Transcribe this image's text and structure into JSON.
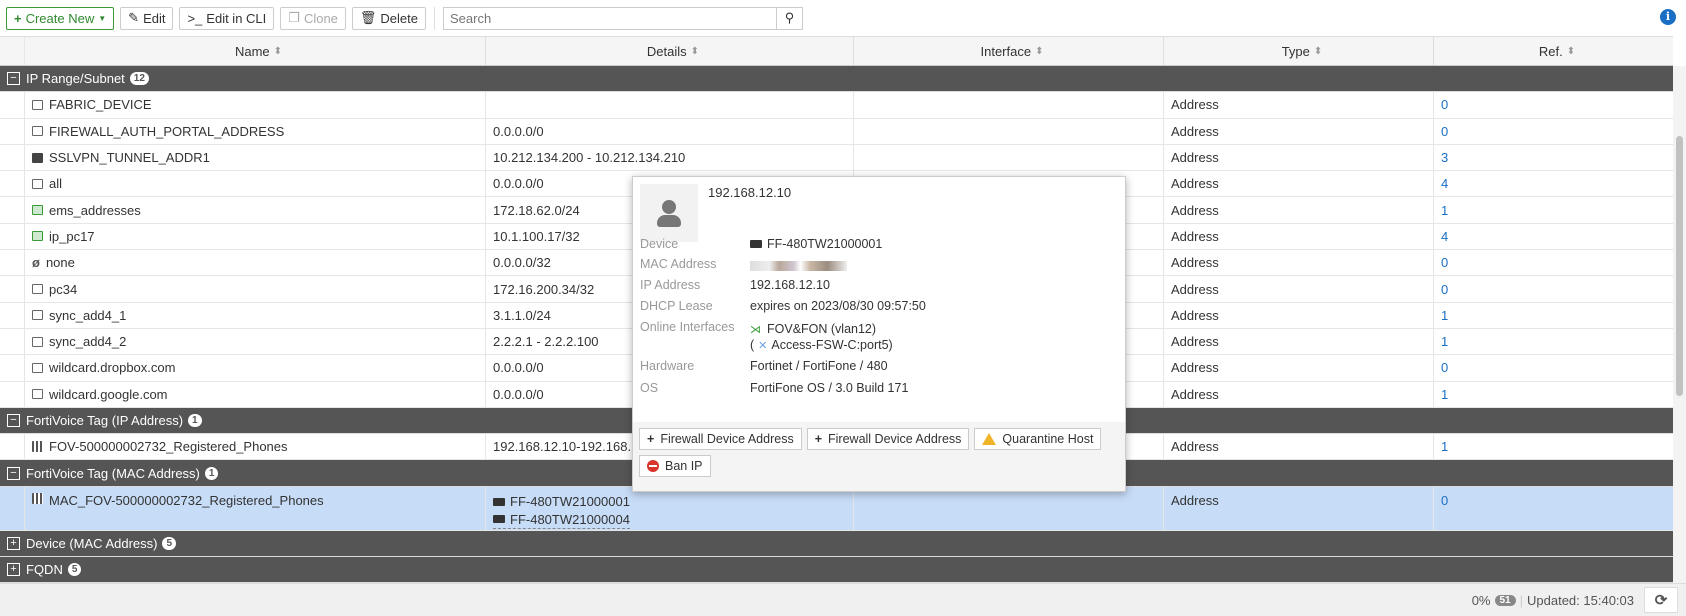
{
  "toolbar": {
    "create_new": "Create New",
    "edit": "Edit",
    "edit_cli": "Edit in CLI",
    "clone": "Clone",
    "delete": "Delete",
    "search_placeholder": "Search"
  },
  "columns": [
    "Name",
    "Details",
    "Interface",
    "Type",
    "Ref."
  ],
  "groups": [
    {
      "label": "IP Range/Subnet",
      "count": "12",
      "expanded": true,
      "rows": [
        {
          "name": "FABRIC_DEVICE",
          "details": "",
          "type": "Address",
          "ref": "0",
          "icon": "address"
        },
        {
          "name": "FIREWALL_AUTH_PORTAL_ADDRESS",
          "details": "0.0.0.0/0",
          "type": "Address",
          "ref": "0",
          "icon": "address"
        },
        {
          "name": "SSLVPN_TUNNEL_ADDR1",
          "details": "10.212.134.200 - 10.212.134.210",
          "type": "Address",
          "ref": "3",
          "icon": "address-dark"
        },
        {
          "name": "all",
          "details": "0.0.0.0/0",
          "type": "Address",
          "ref": "4",
          "icon": "address"
        },
        {
          "name": "ems_addresses",
          "details": "172.18.62.0/24",
          "type": "Address",
          "ref": "1",
          "icon": "address-green"
        },
        {
          "name": "ip_pc17",
          "details": "10.1.100.17/32",
          "type": "Address",
          "ref": "4",
          "icon": "address-green"
        },
        {
          "name": "none",
          "details": "0.0.0.0/32",
          "type": "Address",
          "ref": "0",
          "icon": "none"
        },
        {
          "name": "pc34",
          "details": "172.16.200.34/32",
          "type": "Address",
          "ref": "0",
          "icon": "address"
        },
        {
          "name": "sync_add4_1",
          "details": "3.1.1.0/24",
          "type": "Address",
          "ref": "1",
          "icon": "address"
        },
        {
          "name": "sync_add4_2",
          "details": "2.2.2.1 - 2.2.2.100",
          "type": "Address",
          "ref": "1",
          "icon": "address"
        },
        {
          "name": "wildcard.dropbox.com",
          "details": "0.0.0.0/0",
          "type": "Address",
          "ref": "0",
          "icon": "address"
        },
        {
          "name": "wildcard.google.com",
          "details": "0.0.0.0/0",
          "type": "Address",
          "ref": "1",
          "icon": "address"
        }
      ]
    },
    {
      "label": "FortiVoice Tag (IP Address)",
      "count": "1",
      "expanded": true,
      "rows": [
        {
          "name": "FOV-500000002732_Registered_Phones",
          "details": "192.168.12.10-192.168.12",
          "type": "Address",
          "ref": "1",
          "icon": "grid"
        }
      ]
    },
    {
      "label": "FortiVoice Tag (MAC Address)",
      "count": "1",
      "expanded": true,
      "rows": [
        {
          "name": "MAC_FOV-500000002732_Registered_Phones",
          "details_list": [
            "FF-480TW21000001",
            "FF-480TW21000004"
          ],
          "type": "Address",
          "ref": "0",
          "icon": "grid",
          "selected": true
        }
      ]
    },
    {
      "label": "Device (MAC Address)",
      "count": "5",
      "expanded": false
    },
    {
      "label": "FQDN",
      "count": "5",
      "expanded": false
    }
  ],
  "popup": {
    "title": "192.168.12.10",
    "device_label": "Device",
    "device": "FF-480TW21000001",
    "mac_label": "MAC Address",
    "ip_label": "IP Address",
    "ip": "192.168.12.10",
    "dhcp_label": "DHCP Lease",
    "dhcp": "expires on 2023/08/30 09:57:50",
    "iface_label": "Online Interfaces",
    "iface1": "FOV&FON (vlan12)",
    "iface2": "Access-FSW-C:port5)",
    "iface2_prefix": "(",
    "hw_label": "Hardware",
    "hw": "Fortinet / FortiFone / 480",
    "os_label": "OS",
    "os": "FortiFone OS / 3.0 Build 171",
    "actions": [
      "Firewall Device Address",
      "Firewall Device Address",
      "Quarantine Host",
      "Ban IP"
    ]
  },
  "footer": {
    "percent": "0%",
    "count": "51",
    "updated": "Updated: 15:40:03"
  }
}
